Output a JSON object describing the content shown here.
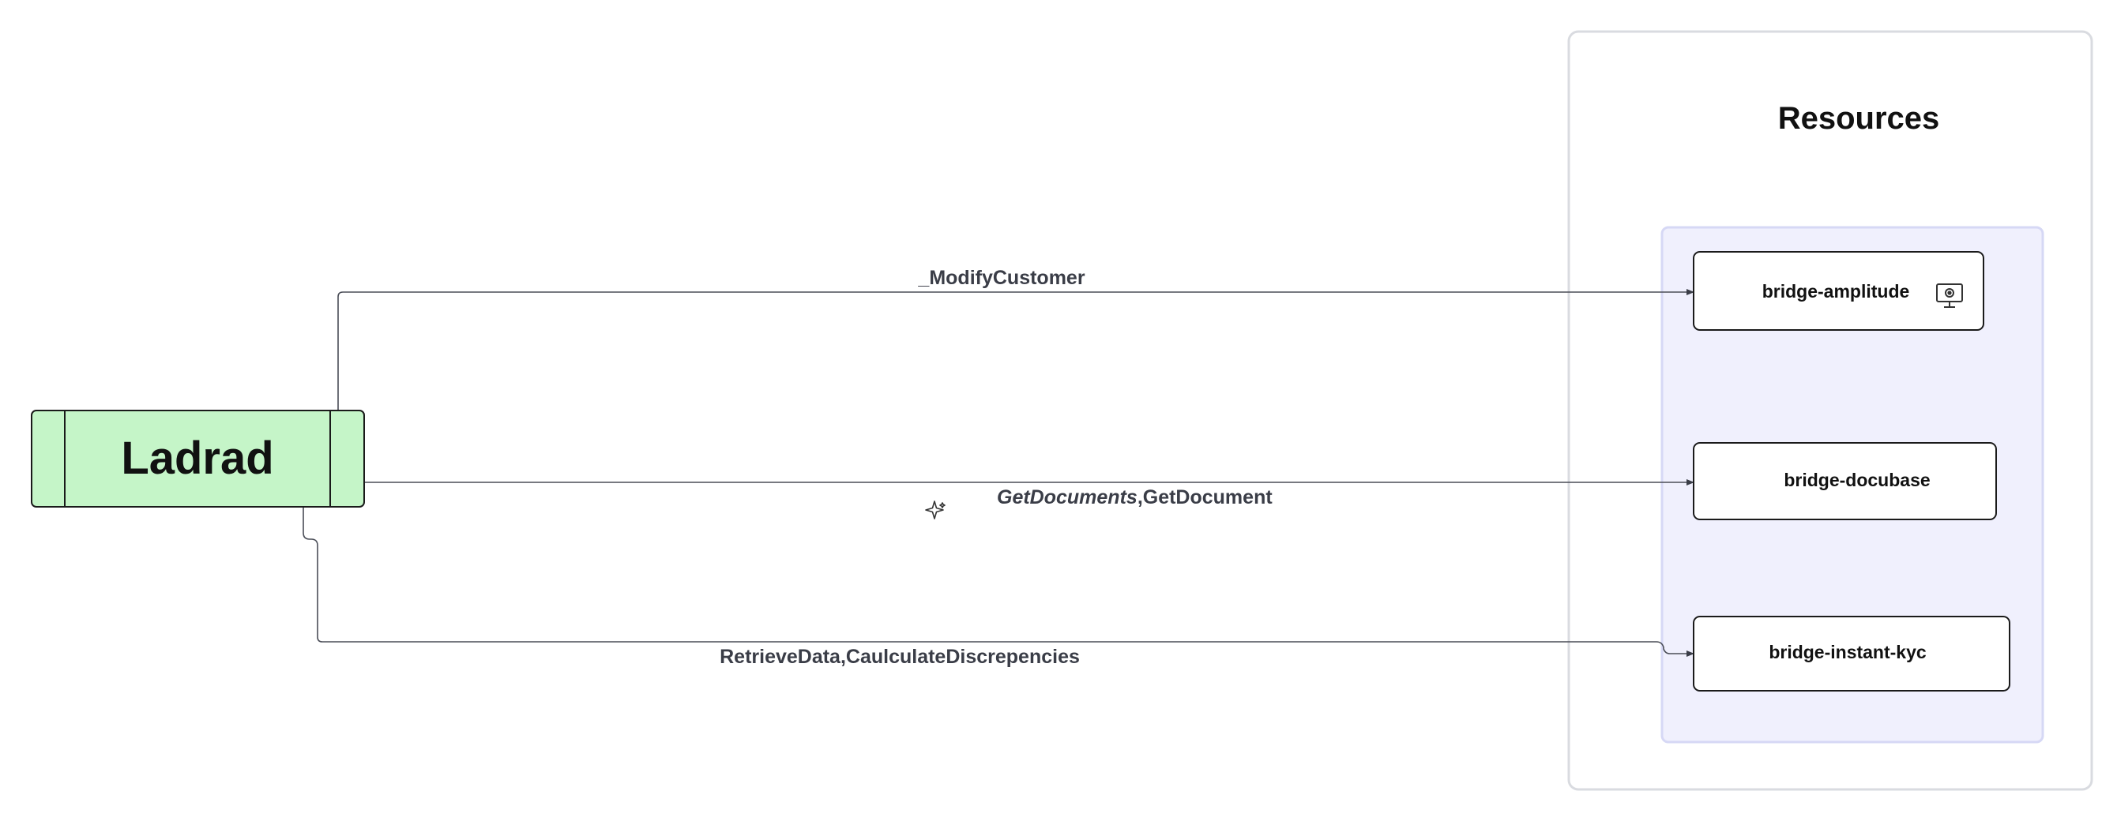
{
  "colors": {
    "background": "#ffffff",
    "service_fill": "#c5f5c8",
    "service_stroke": "#1a1a1a",
    "group_outer_stroke": "#d9dbe0",
    "group_inner_fill": "#f0f0fd",
    "group_inner_stroke": "#d6d8f5",
    "resource_fill": "#ffffff",
    "resource_stroke": "#1a1a1a",
    "edge_stroke": "#4a4d57"
  },
  "service": {
    "title": "Ladrad"
  },
  "group": {
    "title": "Resources"
  },
  "resources": [
    {
      "id": "amplitude",
      "label": "bridge-amplitude",
      "icon": "monitor-icon"
    },
    {
      "id": "docubase",
      "label": "bridge-docubase"
    },
    {
      "id": "instant_kyc",
      "label": "bridge-instant-kyc"
    }
  ],
  "edges": [
    {
      "from": "Ladrad",
      "to": "bridge-amplitude",
      "label": "_ModifyCustomer"
    },
    {
      "from": "Ladrad",
      "to": "bridge-docubase",
      "label_emphasis": "GetDocuments",
      "label": ",GetDocument"
    },
    {
      "from": "Ladrad",
      "to": "bridge-instant-kyc",
      "label": "RetrieveData,CaulculateDiscrepencies"
    }
  ],
  "cursor_icon": "sparkle-icon"
}
